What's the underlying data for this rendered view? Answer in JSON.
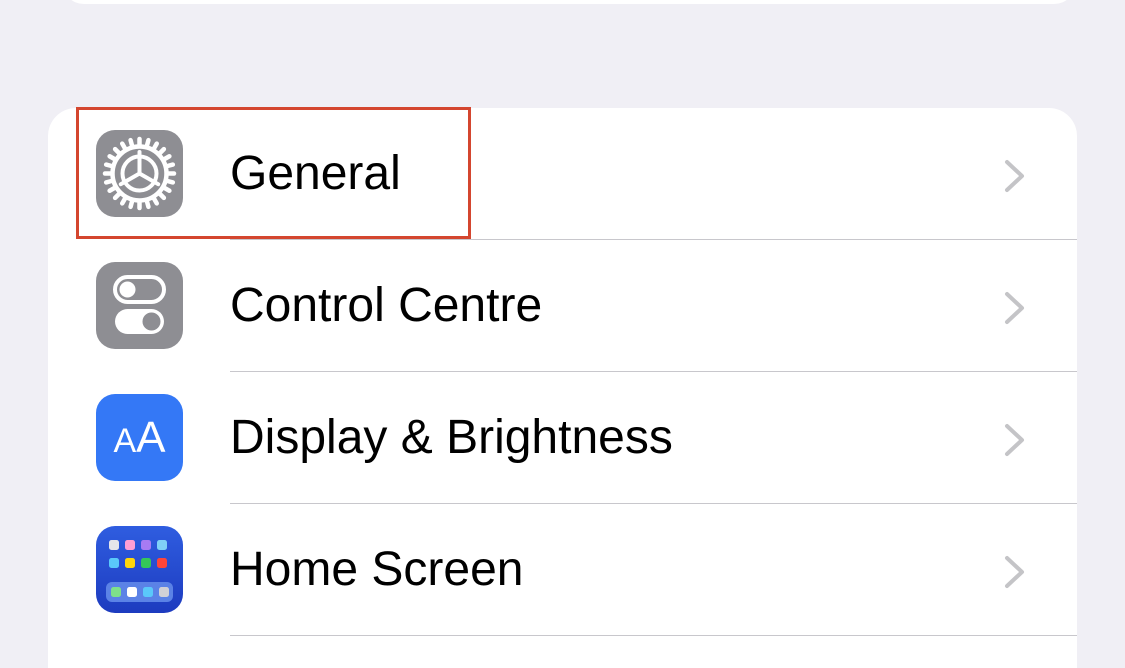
{
  "settings_group": {
    "rows": [
      {
        "label": "General",
        "icon": "gear-icon",
        "icon_bg": "#8e8e93"
      },
      {
        "label": "Control Centre",
        "icon": "toggle-switches-icon",
        "icon_bg": "#8e8e93"
      },
      {
        "label": "Display & Brightness",
        "icon": "text-size-icon",
        "icon_text": "AA",
        "icon_bg": "#3478f6"
      },
      {
        "label": "Home Screen",
        "icon": "app-grid-icon",
        "icon_bg": "#2648d1"
      }
    ]
  },
  "highlight": {
    "target": "General",
    "color": "#d4462f"
  },
  "colors": {
    "background": "#f0eff5",
    "card": "#ffffff",
    "chevron": "#c4c4c7",
    "separator": "#c8c7cc"
  }
}
